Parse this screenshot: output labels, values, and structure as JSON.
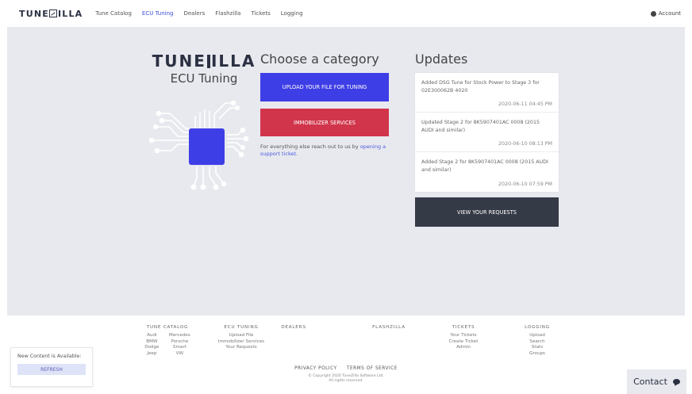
{
  "navbar": {
    "brand_left": "TUNE",
    "brand_right": "ILLA",
    "links": [
      "Tune Catalog",
      "ECU Tuning",
      "Dealers",
      "Flashzilla",
      "Tickets",
      "Logging"
    ],
    "active_link": "ECU Tuning",
    "account_label": "Account",
    "account_icon": "user-circle-icon"
  },
  "hero": {
    "brand_left": "TUNE",
    "brand_right": "ILLA",
    "subtitle": "ECU Tuning",
    "illustration_icon": "circuit-chip-icon"
  },
  "category": {
    "title": "Choose a category",
    "upload_label": "UPLOAD YOUR FILE FOR TUNING",
    "immobilizer_label": "IMMOBILIZER SERVICES",
    "note_prefix": "For everything else reach out to us by ",
    "note_link": "opening a support ticket",
    "note_suffix": "."
  },
  "updates": {
    "title": "Updates",
    "items": [
      {
        "text": "Added DSG Tune for Stock Power to Stage 3 for 02E300062B 4020",
        "date": "2020-06-11 04:45 PM"
      },
      {
        "text": "Updated Stage 2 for 8K5907401AC 0008 (2015 AUDI and similar)",
        "date": "2020-06-10 08:13 PM"
      },
      {
        "text": "Added Stage 2 for 8K5907401AC 0008 (2015 AUDI and similar)",
        "date": "2020-06-10 07:59 PM"
      }
    ],
    "requests_label": "VIEW YOUR REQUESTS"
  },
  "footer": {
    "tune_catalog": {
      "heading": "TUNE CATALOG",
      "col1": [
        "Audi",
        "BMW",
        "Dodge",
        "Jeep"
      ],
      "col2": [
        "Mercedes",
        "Porsche",
        "Smart",
        "VW"
      ]
    },
    "ecu_tuning": {
      "heading": "ECU TUNING",
      "items": [
        "Upload File",
        "Immobilizer Services",
        "Your Requests"
      ]
    },
    "dealers": {
      "heading": "DEALERS"
    },
    "flashzilla": {
      "heading": "FLASHZILLA"
    },
    "tickets": {
      "heading": "TICKETS",
      "items": [
        "Your Tickets",
        "Create Ticket",
        "Admin"
      ]
    },
    "logging": {
      "heading": "LOGGING",
      "items": [
        "Upload",
        "Search",
        "Stats",
        "Groups"
      ]
    },
    "privacy": "PRIVACY POLICY",
    "terms": "TERMS OF SERVICE",
    "copyright_line1": "© Copyright 2020 TuneZilla Software Ltd.",
    "copyright_line2": "All rights reserved."
  },
  "notice": {
    "text": "New Content is Available:",
    "button": "REFRESH"
  },
  "contact": {
    "label": "Contact",
    "icon": "chat-bubble-icon"
  },
  "colors": {
    "primary": "#3e3ee6",
    "danger": "#d1354b",
    "dark": "#353a47",
    "panel": "#e8e9ef",
    "link": "#4a5adf"
  }
}
